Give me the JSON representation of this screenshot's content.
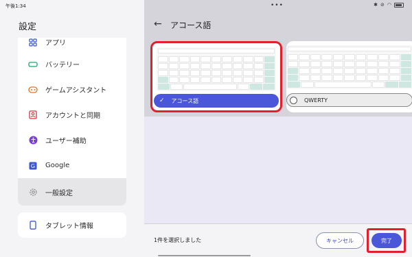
{
  "status_bar": {
    "time": "午後1:34",
    "dots": "•••",
    "icons": [
      "bluetooth-icon",
      "sync-icon",
      "wifi-icon",
      "battery-icon"
    ]
  },
  "settings": {
    "title": "設定",
    "items": [
      {
        "label": "アプリ",
        "icon": "apps-icon",
        "color": "#3a56d6"
      },
      {
        "label": "バッテリー",
        "icon": "battery-icon",
        "color": "#1da36b"
      },
      {
        "label": "ゲームアシスタント",
        "icon": "gamepad-icon",
        "color": "#e8701f"
      },
      {
        "label": "アカウントと同期",
        "icon": "account-icon",
        "color": "#d8343b"
      },
      {
        "label": "ユーザー補助",
        "icon": "accessibility-icon",
        "color": "#7a3fd1"
      },
      {
        "label": "Google",
        "icon": "google-icon",
        "color": "#3a56d6"
      },
      {
        "label": "一般設定",
        "icon": "gear-icon",
        "color": "#888888",
        "active": true
      }
    ],
    "tablet_info": {
      "label": "タブレット情報",
      "icon": "tablet-icon",
      "color": "#3a56d6"
    }
  },
  "page": {
    "back_icon": "back-arrow-icon",
    "title": "アコース語"
  },
  "layouts": [
    {
      "name": "アコース語",
      "selected": true
    },
    {
      "name": "QWERTY",
      "selected": false
    }
  ],
  "bottom": {
    "selected_text": "1件を選択しました",
    "cancel_label": "キャンセル",
    "done_label": "完了"
  },
  "colors": {
    "accent": "#4a57d8",
    "highlight": "#e0202c",
    "key_green": "#cfe7e1"
  }
}
